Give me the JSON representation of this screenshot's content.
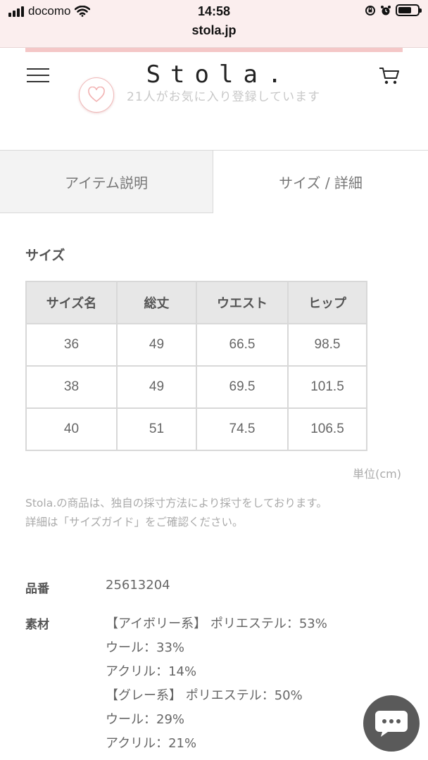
{
  "status_bar": {
    "carrier": "docomo",
    "time": "14:58",
    "url": "stola.jp",
    "battery_level": 0.7
  },
  "header": {
    "brand": "Stola.",
    "menu_icon": "hamburger-menu-icon",
    "cart_icon": "cart-icon"
  },
  "favorite": {
    "icon": "heart-icon",
    "text": "21人がお気に入り登録しています"
  },
  "tabs": [
    {
      "label": "アイテム説明",
      "active": false
    },
    {
      "label": "サイズ / 詳細",
      "active": true
    }
  ],
  "size_section": {
    "title": "サイズ",
    "headers": [
      "サイズ名",
      "総丈",
      "ウエスト",
      "ヒップ"
    ],
    "rows": [
      [
        "36",
        "49",
        "66.5",
        "98.5"
      ],
      [
        "38",
        "49",
        "69.5",
        "101.5"
      ],
      [
        "40",
        "51",
        "74.5",
        "106.5"
      ]
    ],
    "unit": "単位(cm)",
    "note_line1": "Stola.の商品は、独自の採寸方法により採寸をしております。",
    "note_line2": "詳細は「サイズガイド」をご確認ください。"
  },
  "specs": {
    "product_no_label": "品番",
    "product_no": "25613204",
    "material_label": "素材",
    "material_lines": [
      "【アイボリー系】 ポリエステル：53%",
      "ウール：33%",
      "アクリル：14%",
      "【グレー系】 ポリエステル：50%",
      "ウール：29%",
      "アクリル：21%"
    ]
  },
  "chat": {
    "icon": "chat-bubble-icon"
  },
  "colors": {
    "accent_pink": "#f4c7c7",
    "status_bg": "#fbeeee",
    "chat_bg": "#5a5a5a"
  }
}
